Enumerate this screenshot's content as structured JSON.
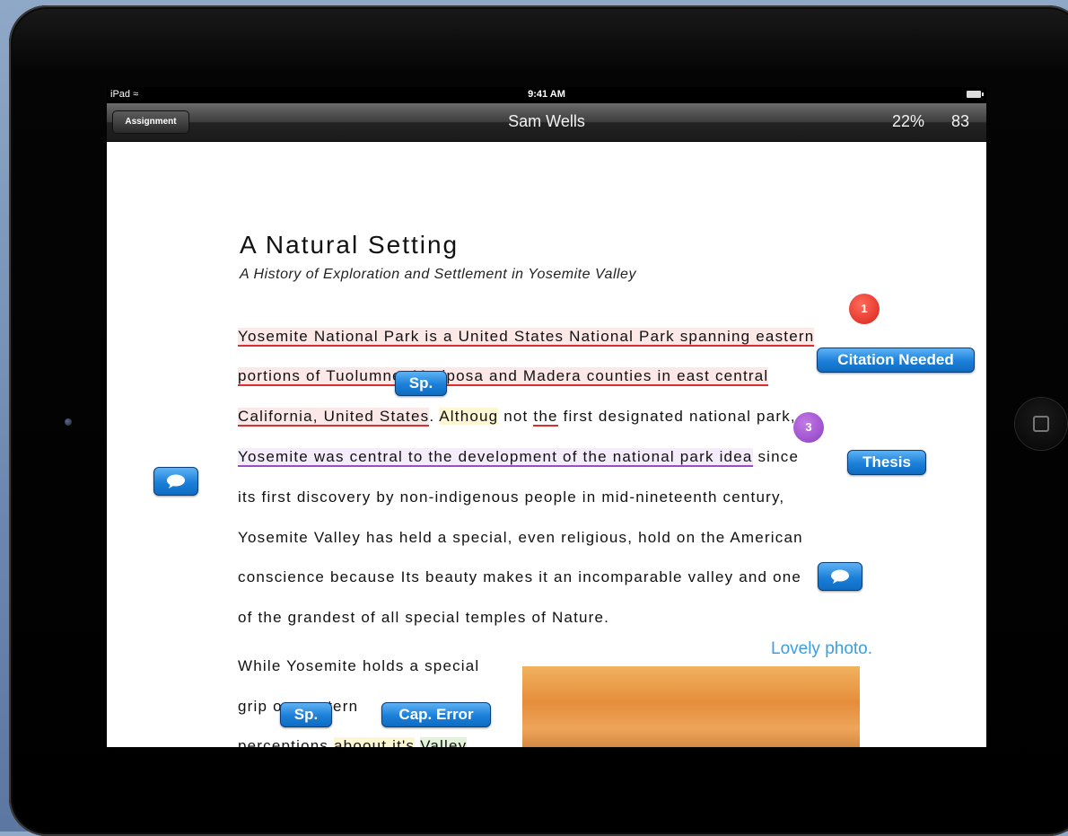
{
  "status_bar": {
    "device": "iPad",
    "time": "9:41 AM"
  },
  "nav": {
    "assignment_button": "Assignment",
    "title": "Sam Wells",
    "percent": "22%",
    "score": "83"
  },
  "document": {
    "title": "A Natural Setting",
    "subtitle": "A History of Exploration and Settlement in Yosemite Valley",
    "p1": {
      "l1": "Yosemite National Park is a United States National Park spanning eastern",
      "l2": "portions of Tuolumne, Mariposa and Madera counties in east central",
      "l3a": "California, United States",
      "l3b": ". ",
      "l3c": "Althoug",
      "l3d": " not ",
      "l3e": "the",
      "l3f": " first designated national park,",
      "l4a": "Yosemite was central to the development of the national park idea",
      "l4b": " since",
      "l5": "its first discovery by non-indigenous people in mid-nineteenth century,",
      "l6": "Yosemite Valley has held a special, even religious, hold on the American",
      "l7": "conscience because Its beauty makes it an incomparable valley and one",
      "l8": "of the grandest of all special temples of Nature."
    },
    "p2": {
      "l1": "While Yosemite holds a special",
      "l2": "grip on western",
      "l3a": "perceptions ",
      "l3b": "aboout it's",
      "l3c": " ",
      "l3d": "Valley"
    }
  },
  "annotations": {
    "badge_1": "1",
    "badge_3": "3",
    "citation": "Citation Needed",
    "sp1": "Sp.",
    "thesis": "Thesis",
    "sp2": "Sp.",
    "cap_error": "Cap. Error",
    "comment_text": "Lovely photo."
  },
  "colors": {
    "tag_blue": "#1b7fd8",
    "error_red": "#d9302f",
    "thesis_purple": "#9b4ec4",
    "comment_blue": "#3a9fe0"
  },
  "icons": [
    "wifi-icon",
    "battery-icon",
    "speech-bubble-icon",
    "home-button-icon"
  ]
}
